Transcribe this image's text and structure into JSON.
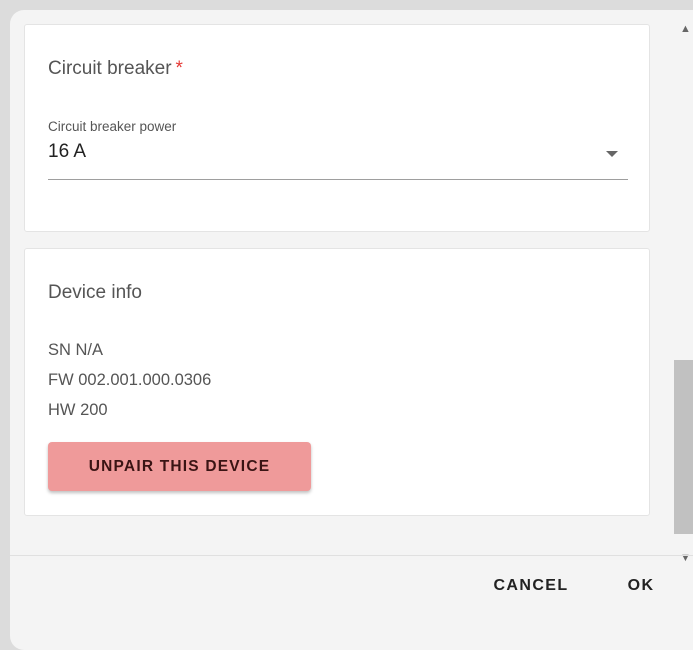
{
  "circuit_breaker": {
    "title": "Circuit breaker",
    "required_mark": "*",
    "select": {
      "label": "Circuit breaker power",
      "value": "16 A"
    }
  },
  "device_info": {
    "title": "Device info",
    "sn": "SN N/A",
    "fw": "FW 002.001.000.0306",
    "hw": "HW 200",
    "unpair_label": "UNPAIR THIS DEVICE"
  },
  "scrollbar": {
    "up_icon": "chevron-up-icon",
    "down_icon": "chevron-down-icon"
  },
  "footer": {
    "cancel_label": "CANCEL",
    "ok_label": "OK"
  },
  "colors": {
    "required": "#e53935",
    "unpair_button": "#ef9a9a",
    "dialog_bg": "#f4f4f4"
  }
}
